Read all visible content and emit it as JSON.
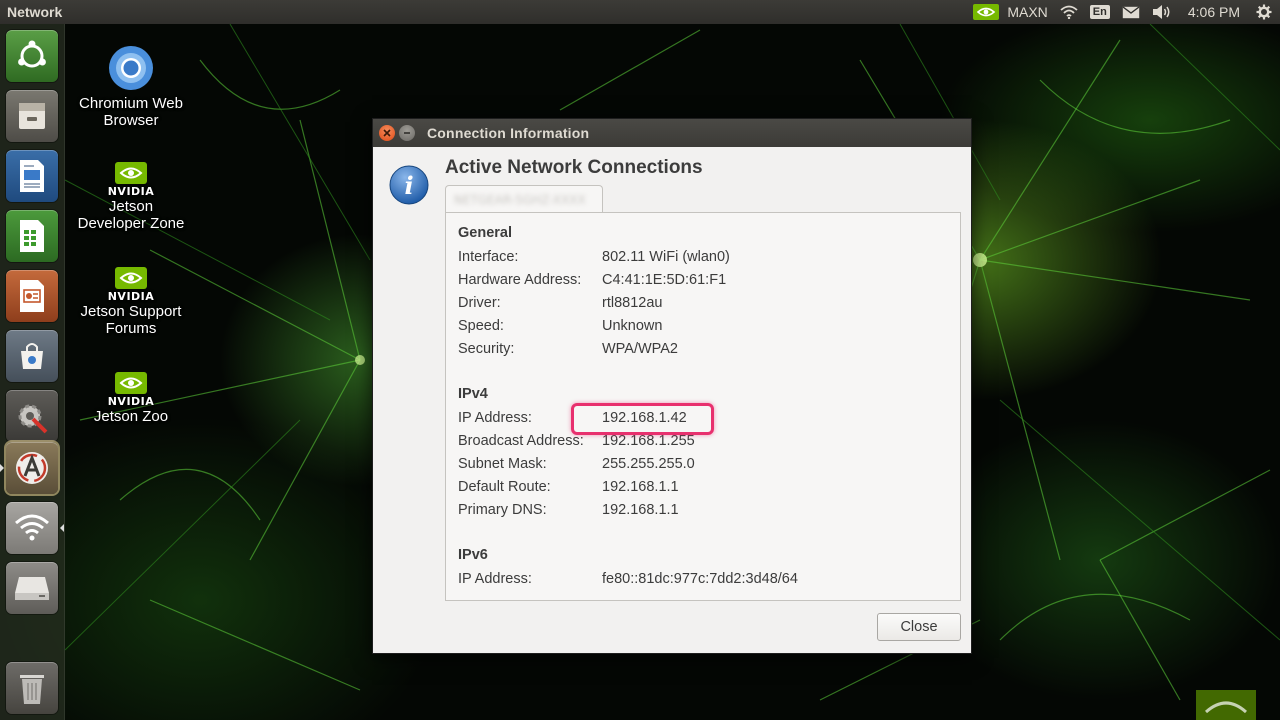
{
  "top_panel": {
    "app_title": "Network",
    "power_mode": "MAXN",
    "keyboard_layout": "En",
    "clock": "4:06 PM"
  },
  "launcher": {
    "items": [
      {
        "icon": "ubuntu-dash-icon"
      },
      {
        "icon": "files-icon"
      },
      {
        "icon": "libreoffice-writer-icon"
      },
      {
        "icon": "libreoffice-calc-icon"
      },
      {
        "icon": "libreoffice-impress-icon"
      },
      {
        "icon": "software-center-icon"
      },
      {
        "icon": "system-settings-icon"
      },
      {
        "icon": "software-updater-icon"
      },
      {
        "icon": "network-wifi-icon"
      },
      {
        "icon": "drive-icon"
      },
      {
        "icon": "trash-icon"
      }
    ]
  },
  "desktop": {
    "icons": [
      {
        "label": "Chromium Web Browser",
        "icon": "chromium-icon"
      },
      {
        "brand": "NVIDIA",
        "label": "Jetson Developer Zone",
        "icon": "nvidia-icon"
      },
      {
        "brand": "NVIDIA",
        "label": "Jetson Support Forums",
        "icon": "nvidia-icon"
      },
      {
        "brand": "NVIDIA",
        "label": "Jetson Zoo",
        "icon": "nvidia-icon"
      }
    ]
  },
  "dialog": {
    "title": "Connection Information",
    "heading": "Active Network Connections",
    "tab_label": "NETGEAR-5GHZ-XXXX",
    "general": {
      "title": "General",
      "rows": [
        {
          "label": "Interface:",
          "value": "802.11 WiFi (wlan0)"
        },
        {
          "label": "Hardware Address:",
          "value": "C4:41:1E:5D:61:F1"
        },
        {
          "label": "Driver:",
          "value": "rtl8812au"
        },
        {
          "label": "Speed:",
          "value": "Unknown"
        },
        {
          "label": "Security:",
          "value": "WPA/WPA2"
        }
      ]
    },
    "ipv4": {
      "title": "IPv4",
      "rows": [
        {
          "label": "IP Address:",
          "value": "192.168.1.42"
        },
        {
          "label": "Broadcast Address:",
          "value": "192.168.1.255"
        },
        {
          "label": "Subnet Mask:",
          "value": "255.255.255.0"
        },
        {
          "label": "Default Route:",
          "value": "192.168.1.1"
        },
        {
          "label": "Primary DNS:",
          "value": "192.168.1.1"
        }
      ]
    },
    "ipv6": {
      "title": "IPv6",
      "rows": [
        {
          "label": "IP Address:",
          "value": "fe80::81dc:977c:7dd2:3d48/64"
        }
      ]
    },
    "close_label": "Close",
    "highlight_color": "#e8306e"
  }
}
